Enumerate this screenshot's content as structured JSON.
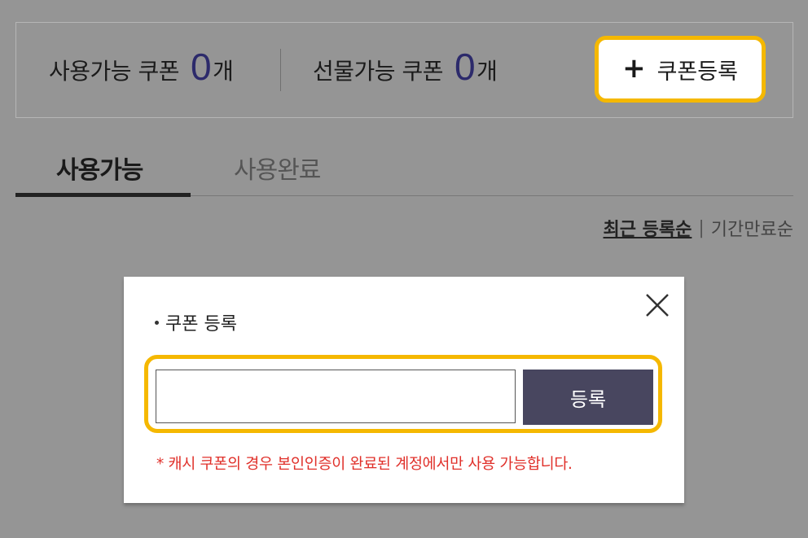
{
  "summary": {
    "usable_label": "사용가능 쿠폰",
    "usable_count": "0",
    "unit": "개",
    "gift_label": "선물가능 쿠폰",
    "gift_count": "0",
    "register_button": "쿠폰등록",
    "register_icon": "plus-icon"
  },
  "tabs": [
    {
      "label": "사용가능",
      "active": true
    },
    {
      "label": "사용완료",
      "active": false
    }
  ],
  "sort": {
    "recent": "최근 등록순",
    "separator": "|",
    "expiry": "기간만료순"
  },
  "modal": {
    "title": "쿠폰 등록",
    "close_icon": "close-icon",
    "input_value": "",
    "input_placeholder": "",
    "submit_label": "등록",
    "notice": "* 캐시 쿠폰의 경우 본인인증이 완료된 계정에서만 사용 가능합니다."
  },
  "colors": {
    "highlight": "#f5b800",
    "count": "#2c2a6b",
    "submit_bg": "#48465f",
    "notice": "#e0302a",
    "overlay": "#959595"
  }
}
